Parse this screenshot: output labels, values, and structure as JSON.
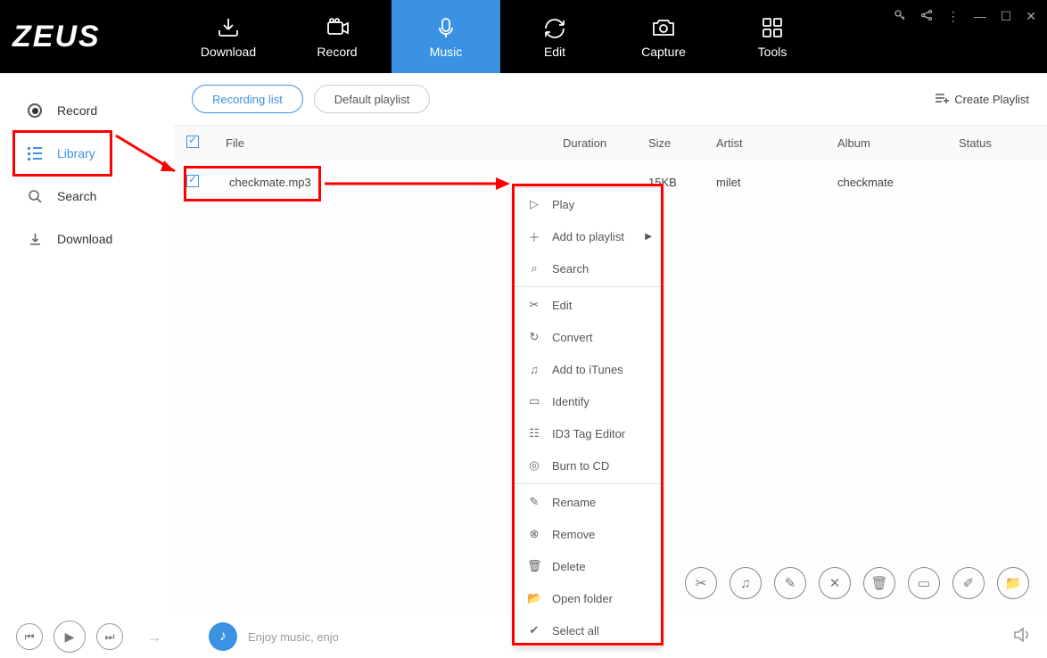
{
  "logo": "ZEUS",
  "nav": [
    {
      "label": "Download"
    },
    {
      "label": "Record"
    },
    {
      "label": "Music"
    },
    {
      "label": "Edit"
    },
    {
      "label": "Capture"
    },
    {
      "label": "Tools"
    }
  ],
  "sidebar": {
    "record": "Record",
    "library": "Library",
    "search": "Search",
    "download": "Download"
  },
  "toolbar": {
    "recording_list": "Recording list",
    "default_playlist": "Default playlist",
    "create_playlist": "Create Playlist"
  },
  "columns": {
    "file": "File",
    "duration": "Duration",
    "size": "Size",
    "artist": "Artist",
    "album": "Album",
    "status": "Status"
  },
  "row": {
    "file": "checkmate.mp3",
    "duration": "",
    "size": "15KB",
    "artist": "milet",
    "album": "checkmate",
    "status": ""
  },
  "context": {
    "play": "Play",
    "add_to_playlist": "Add to playlist",
    "search": "Search",
    "edit": "Edit",
    "convert": "Convert",
    "add_to_itunes": "Add to iTunes",
    "identify": "Identify",
    "id3": "ID3 Tag Editor",
    "burn": "Burn to CD",
    "rename": "Rename",
    "remove": "Remove",
    "delete": "Delete",
    "open_folder": "Open folder",
    "select_all": "Select all"
  },
  "player": {
    "text": "Enjoy music, enjo"
  }
}
